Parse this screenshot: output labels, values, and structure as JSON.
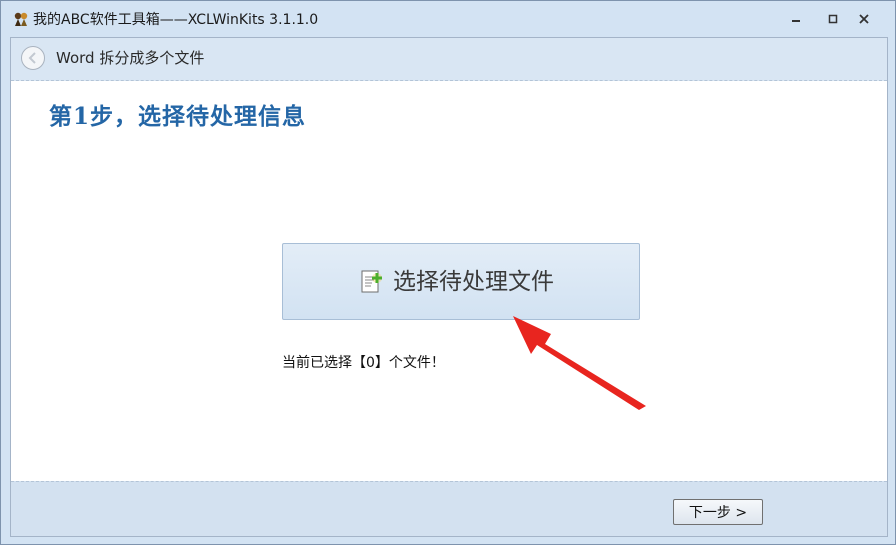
{
  "window": {
    "title": "我的ABC软件工具箱——XCLWinKits  3.1.1.0"
  },
  "header": {
    "title": "Word 拆分成多个文件"
  },
  "main": {
    "step_title": "第1步，选择待处理信息",
    "select_button_label": "选择待处理文件",
    "status_text": "当前已选择【0】个文件！"
  },
  "footer": {
    "next_label": "下一步 >"
  },
  "icons": {
    "app": "app-icon",
    "back": "back-circle-icon",
    "file_add": "file-add-icon",
    "annotation": "red-arrow-icon"
  },
  "colors": {
    "accent_title": "#2466a6",
    "arrow": "#e8251f",
    "chrome": "#d3e3f3"
  }
}
